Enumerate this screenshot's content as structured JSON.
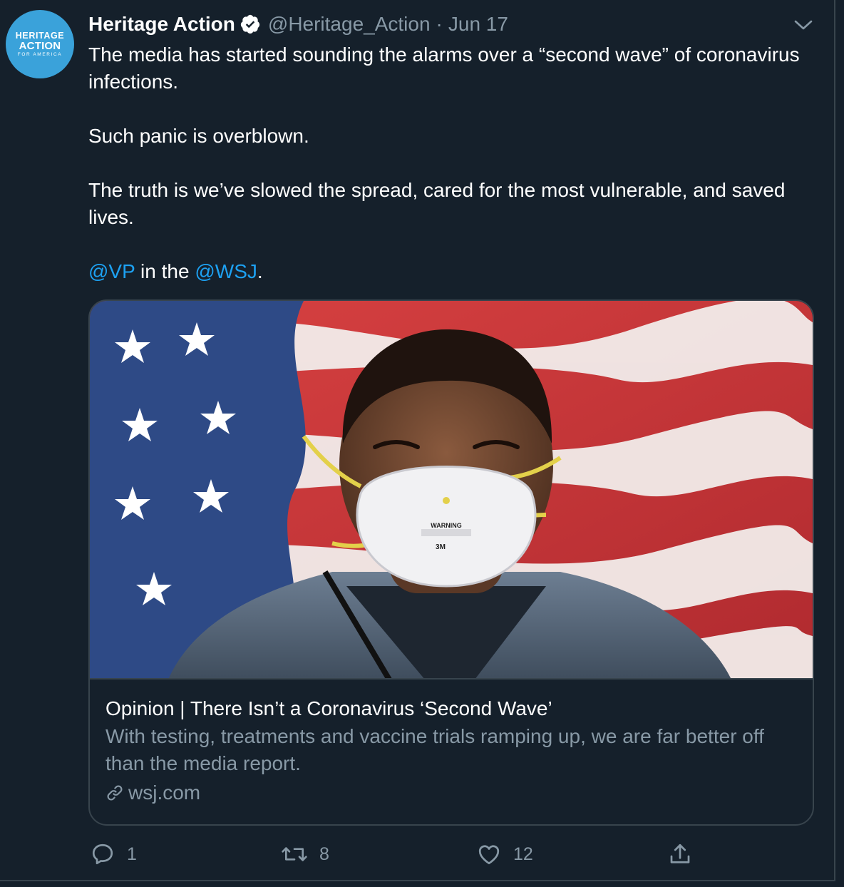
{
  "tweet": {
    "avatar": {
      "line1": "HERITAGE",
      "line2": "ACTION",
      "line3": "FOR AMERICA"
    },
    "name": "Heritage Action",
    "handle": "@Heritage_Action",
    "separator": "·",
    "date": "Jun 17",
    "text": {
      "p1": "The media has started sounding the alarms over a “second wave” of coronavirus infections.",
      "p2": "Such panic is overblown.",
      "p3": "The truth is we’ve slowed the spread, cared for the most vulnerable, and saved lives.",
      "mention1": "@VP",
      "mid": " in the ",
      "mention2": "@WSJ",
      "end": "."
    }
  },
  "card": {
    "title": "Opinion | There Isn’t a Coronavirus ‘Second Wave’",
    "description": "With testing, treatments and vaccine trials ramping up, we are far better off than the media report.",
    "domain": "wsj.com",
    "image": {
      "mask_text": "WARNING",
      "mask_brand": "3M"
    }
  },
  "actions": {
    "reply_count": "1",
    "retweet_count": "8",
    "like_count": "12"
  },
  "icons": {
    "verified": "verified-badge-icon",
    "caret": "chevron-down-icon",
    "reply": "reply-icon",
    "retweet": "retweet-icon",
    "like": "heart-icon",
    "share": "share-icon",
    "link": "link-icon"
  },
  "colors": {
    "background": "#15202b",
    "border": "#38444d",
    "secondary_text": "#8899a6",
    "accent": "#1da1f2",
    "avatar_bg": "#3aa2da"
  }
}
